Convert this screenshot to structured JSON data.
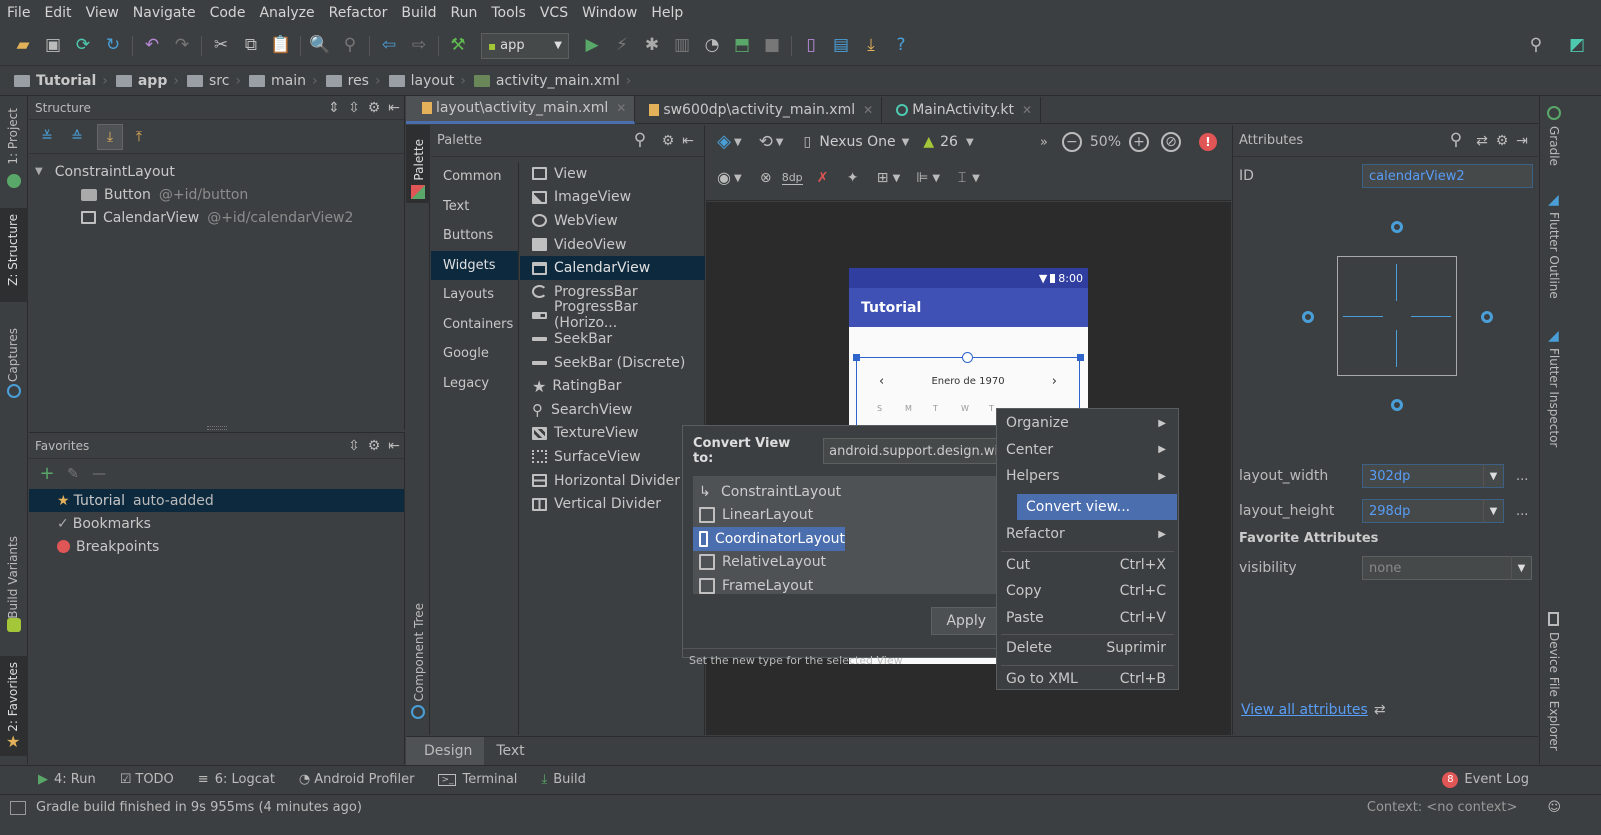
{
  "menu": [
    "File",
    "Edit",
    "View",
    "Navigate",
    "Code",
    "Analyze",
    "Refactor",
    "Build",
    "Run",
    "Tools",
    "VCS",
    "Window",
    "Help"
  ],
  "toolbar": {
    "run_config": "app",
    "device": "Nexus One",
    "api": "26",
    "zoom": "50%"
  },
  "breadcrumb": [
    "Tutorial",
    "app",
    "src",
    "main",
    "res",
    "layout",
    "activity_main.xml"
  ],
  "left_stripe": [
    "1: Project",
    "Z: Structure",
    "Captures",
    "Build Variants",
    "2: Favorites"
  ],
  "structure": {
    "title": "Structure",
    "root": "ConstraintLayout",
    "children": [
      {
        "name": "Button",
        "id": "@+id/button"
      },
      {
        "name": "CalendarView",
        "id": "@+id/calendarView2"
      }
    ]
  },
  "favorites": {
    "title": "Favorites",
    "items": [
      {
        "name": "Tutorial",
        "note": "auto-added"
      },
      {
        "name": "Bookmarks",
        "note": ""
      },
      {
        "name": "Breakpoints",
        "note": ""
      }
    ]
  },
  "tabs": [
    {
      "label": "layout\\activity_main.xml",
      "active": true
    },
    {
      "label": "sw600dp\\activity_main.xml",
      "active": false
    },
    {
      "label": "MainActivity.kt",
      "active": false
    }
  ],
  "palette": {
    "title": "Palette",
    "vertical_label": "Palette",
    "categories": [
      "Common",
      "Text",
      "Buttons",
      "Widgets",
      "Layouts",
      "Containers",
      "Google",
      "Legacy"
    ],
    "selected_category": "Widgets",
    "items": [
      "View",
      "ImageView",
      "WebView",
      "VideoView",
      "CalendarView",
      "ProgressBar",
      "ProgressBar (Horizo...",
      "SeekBar",
      "SeekBar (Discrete)",
      "RatingBar",
      "SearchView",
      "TextureView",
      "SurfaceView",
      "Horizontal Divider",
      "Vertical Divider"
    ],
    "selected_item": "CalendarView"
  },
  "component_tree_label": "Component Tree",
  "design": {
    "dp_label": "8dp",
    "phone_time": "8:00",
    "app_title": "Tutorial",
    "calendar_month": "Enero de 1970",
    "weekdays": [
      "S",
      "M",
      "T",
      "W",
      "T"
    ]
  },
  "convert_dialog": {
    "label": "Convert View to:",
    "value": "android.support.design.widget",
    "options": [
      "ConstraintLayout",
      "LinearLayout",
      "CoordinatorLayout",
      "RelativeLayout",
      "FrameLayout"
    ],
    "selected": "CoordinatorLayout",
    "apply": "Apply",
    "status": "Set the new type for the selected View"
  },
  "context_menu": [
    {
      "label": "Organize",
      "shortcut": "",
      "submenu": true
    },
    {
      "label": "Center",
      "shortcut": "",
      "submenu": true
    },
    {
      "label": "Helpers",
      "shortcut": "",
      "submenu": true
    },
    {
      "label": "Convert view...",
      "shortcut": "",
      "submenu": false,
      "selected": true
    },
    {
      "label": "Refactor",
      "shortcut": "",
      "submenu": true
    },
    {
      "label": "Cut",
      "shortcut": "Ctrl+X",
      "submenu": false
    },
    {
      "label": "Copy",
      "shortcut": "Ctrl+C",
      "submenu": false
    },
    {
      "label": "Paste",
      "shortcut": "Ctrl+V",
      "submenu": false
    },
    {
      "label": "Delete",
      "shortcut": "Suprimir",
      "submenu": false
    },
    {
      "label": "Go to XML",
      "shortcut": "Ctrl+B",
      "submenu": false
    }
  ],
  "attributes": {
    "title": "Attributes",
    "id_label": "ID",
    "id_value": "calendarView2",
    "layout_width_label": "layout_width",
    "layout_width": "302dp",
    "layout_height_label": "layout_height",
    "layout_height": "298dp",
    "favorites_header": "Favorite Attributes",
    "visibility_label": "visibility",
    "visibility": "none",
    "view_all": "View all attributes",
    "more": "..."
  },
  "right_stripe": [
    "Gradle",
    "Flutter Outline",
    "Flutter Inspector",
    "Device File Explorer"
  ],
  "editor_tabs": [
    "Design",
    "Text"
  ],
  "bottom_tools": [
    "4: Run",
    "TODO",
    "6: Logcat",
    "Android Profiler",
    "Terminal",
    "Build"
  ],
  "event_log": {
    "label": "Event Log",
    "count": "8"
  },
  "status": {
    "message": "Gradle build finished in 9s 955ms (4 minutes ago)",
    "context": "Context: <no context>"
  },
  "colors": {
    "accent": "#4b6eaf",
    "selection": "#0d293e",
    "blueprint": "#2f65ca",
    "primary": "#3f51b5",
    "run_green": "#59a869"
  }
}
